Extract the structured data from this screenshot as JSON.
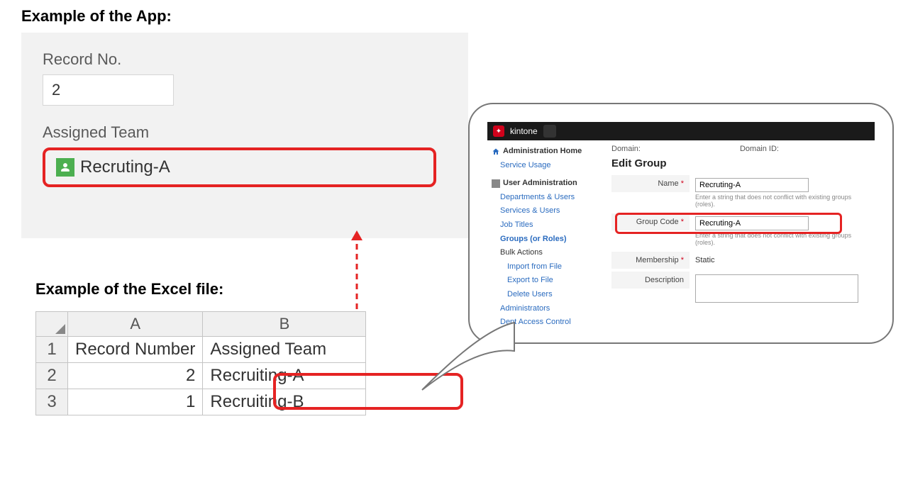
{
  "app_example": {
    "heading": "Example of the App:",
    "record_label": "Record No.",
    "record_value": "2",
    "team_label": "Assigned Team",
    "team_value": "Recruting-A"
  },
  "excel_example": {
    "heading": "Example of the Excel file:",
    "columns": {
      "A": "A",
      "B": "B"
    },
    "header_row": {
      "num": "1",
      "a": "Record Number",
      "b": "Assigned Team"
    },
    "rows": [
      {
        "num": "2",
        "a": "2",
        "b": "Recruiting-A"
      },
      {
        "num": "3",
        "a": "1",
        "b": "Recruiting-B"
      }
    ]
  },
  "admin": {
    "brand": "kintone",
    "nav": {
      "home": "Administration Home",
      "service_usage": "Service Usage",
      "user_admin": "User Administration",
      "dept_users": "Departments & Users",
      "services_users": "Services & Users",
      "job_titles": "Job Titles",
      "groups": "Groups (or Roles)",
      "bulk_actions": "Bulk Actions",
      "import": "Import from File",
      "export": "Export to File",
      "delete_users": "Delete Users",
      "admins": "Administrators",
      "dept_access": "Dept Access Control"
    },
    "main": {
      "domain_label": "Domain:",
      "domain_id_label": "Domain ID:",
      "title": "Edit Group",
      "name_label": "Name",
      "name_value": "Recruting-A",
      "name_hint": "Enter a string that does not conflict with existing groups (roles).",
      "code_label": "Group Code",
      "code_value": "Recruting-A",
      "code_hint": "Enter a string that does not conflict with existing groups (roles).",
      "membership_label": "Membership",
      "membership_value": "Static",
      "description_label": "Description",
      "required_mark": "*"
    }
  }
}
